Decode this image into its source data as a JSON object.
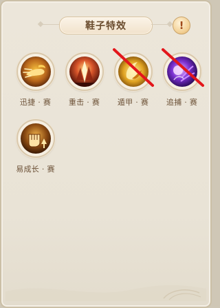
{
  "panel": {
    "title": "鞋子特效",
    "info_glyph": "!",
    "info_icon": "exclamation-icon"
  },
  "effects": [
    {
      "name": "迅捷",
      "suffix": "赛",
      "icon": "dash-icon",
      "crossed_out": false,
      "theme": "gold"
    },
    {
      "name": "重击",
      "suffix": "赛",
      "icon": "smash-icon",
      "crossed_out": false,
      "theme": "fire"
    },
    {
      "name": "遁甲",
      "suffix": "赛",
      "icon": "shield-icon",
      "crossed_out": true,
      "theme": "gold"
    },
    {
      "name": "追捕",
      "suffix": "赛",
      "icon": "chase-icon",
      "crossed_out": true,
      "theme": "purple"
    },
    {
      "name": "易成长",
      "suffix": "赛",
      "icon": "growth-fist-icon",
      "crossed_out": false,
      "theme": "brown"
    }
  ],
  "colors": {
    "panel_bg": "#ece6da",
    "label_text": "#6d5238",
    "title_text": "#6a4c2e",
    "cross_line": "#e3161b"
  }
}
